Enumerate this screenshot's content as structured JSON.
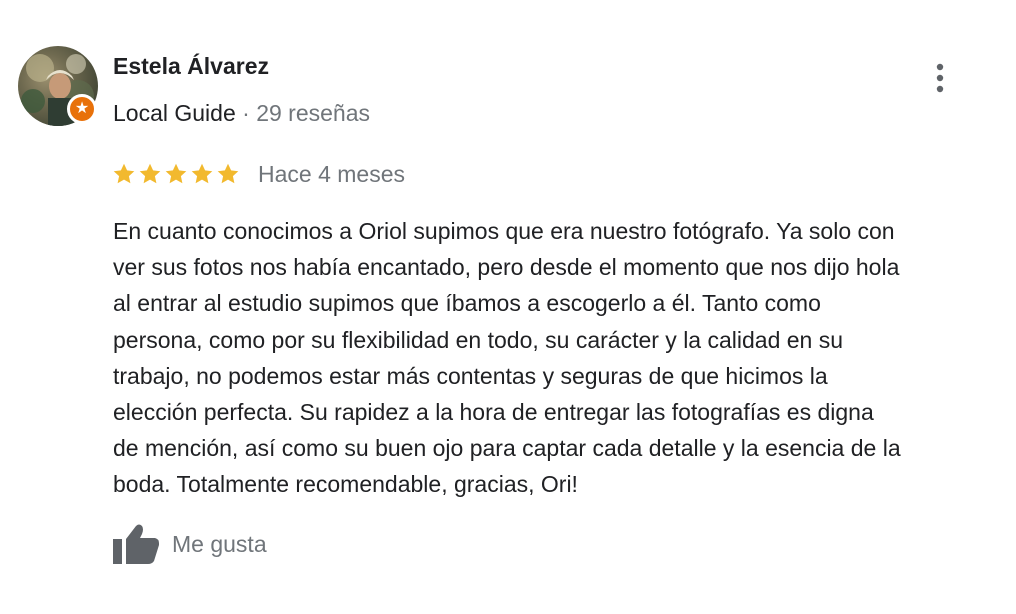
{
  "reviewer": {
    "name": "Estela Álvarez",
    "badge": "Local Guide",
    "separator": "·",
    "reviews_count": "29 reseñas",
    "avatar_icon": "user-photo",
    "badge_icon": "star-icon",
    "badge_color": "#e8710a"
  },
  "rating": {
    "stars": 5,
    "max_stars": 5,
    "star_color": "#f2b92e",
    "time": "Hace 4 meses"
  },
  "review": {
    "lines": [
      "En cuanto conocimos a Oriol supimos que era nuestro fotógrafo. Ya solo con",
      "ver sus fotos nos había encantado, pero desde el momento que nos dijo hola",
      "al entrar al estudio supimos que íbamos a escogerlo a él. Tanto como",
      "persona, como por su flexibilidad en todo, su carácter y la calidad en su",
      "trabajo, no podemos estar más contentas y seguras de que hicimos la",
      "elección perfecta. Su rapidez a la hora de entregar las fotografías es digna",
      "de mención, así como su buen ojo para captar cada detalle y la esencia de la",
      "boda. Totalmente recomendable, gracias, Ori!"
    ]
  },
  "actions": {
    "like_label": "Me gusta",
    "like_icon": "thumbs-up-icon",
    "more_icon": "more-vert-icon"
  }
}
